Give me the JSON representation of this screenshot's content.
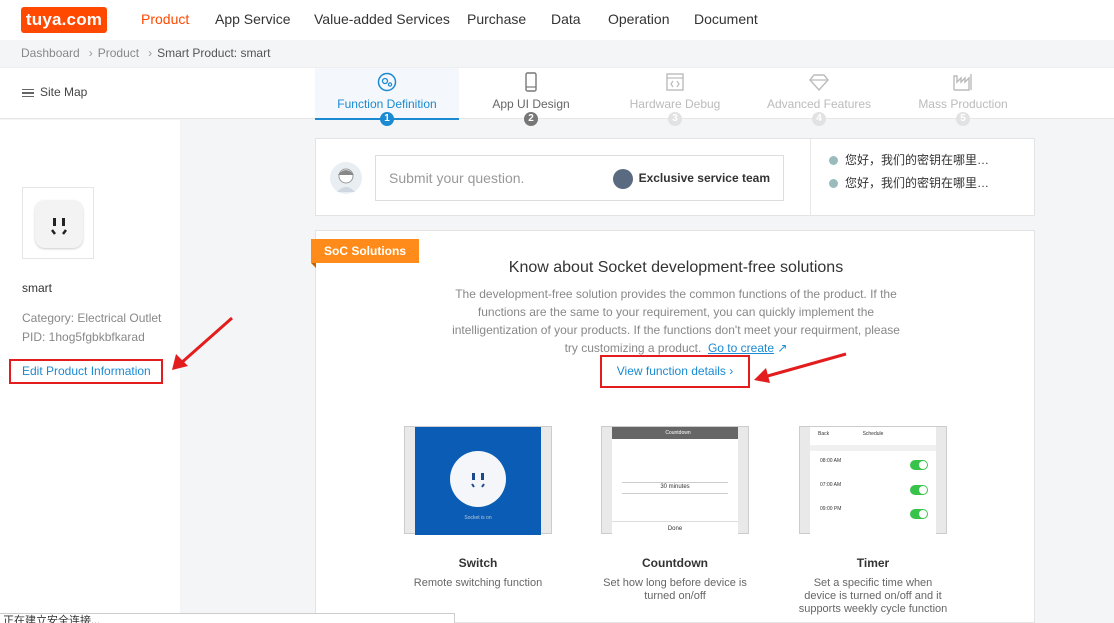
{
  "logo": "tuya.com",
  "nav": [
    "Product",
    "App Service",
    "Value-added Services",
    "Purchase",
    "Data",
    "Operation",
    "Document"
  ],
  "breadcrumb": {
    "home": "Dashboard",
    "mid": "Product",
    "current": "Smart Product: smart"
  },
  "sitemap": "Site Map",
  "steps": [
    {
      "label": "Function Definition",
      "num": "1",
      "icon": "gear-icon"
    },
    {
      "label": "App UI Design",
      "num": "2",
      "icon": "phone-icon"
    },
    {
      "label": "Hardware Debug",
      "num": "3",
      "icon": "code-icon"
    },
    {
      "label": "Advanced Features",
      "num": "4",
      "icon": "diamond-icon"
    },
    {
      "label": "Mass Production",
      "num": "5",
      "icon": "factory-icon"
    }
  ],
  "product": {
    "name": "smart",
    "category": "Category: Electrical Outlet",
    "pid": "PID: 1hog5fgbkbfkarad",
    "edit": "Edit Product Information"
  },
  "question": {
    "placeholder": "Submit your question.",
    "team": "Exclusive service team",
    "faqs": [
      "您好，我们的密钥在哪里…",
      "您好，我们的密钥在哪里…"
    ]
  },
  "soc": {
    "tag": "SoC Solutions",
    "heading": "Know about Socket development-free solutions",
    "desc": "The development-free solution provides the common functions of the product. If the functions are the same to your requirement, you can quickly implement the intelligentization of your products. If the functions don't meet your requirment, please try customizing a product.",
    "link": "Go to create",
    "view": "View function details"
  },
  "cards": [
    {
      "title": "Switch",
      "sub": "Remote switching function",
      "screen_caption": "Socket is on"
    },
    {
      "title": "Countdown",
      "sub": "Set how long before device  is turned on/off",
      "screen_header": "Countdown",
      "screen_value": "30   minutes",
      "screen_footer": "Done"
    },
    {
      "title": "Timer",
      "sub": "Set a specific time when device is turned on/off and it supports weekly cycle function",
      "screen_header": "Schedule",
      "screen_back": "Back",
      "times": [
        "08:00 AM",
        "07:00 AM",
        "09:00 PM"
      ]
    }
  ],
  "status": "正在建立安全连接..."
}
